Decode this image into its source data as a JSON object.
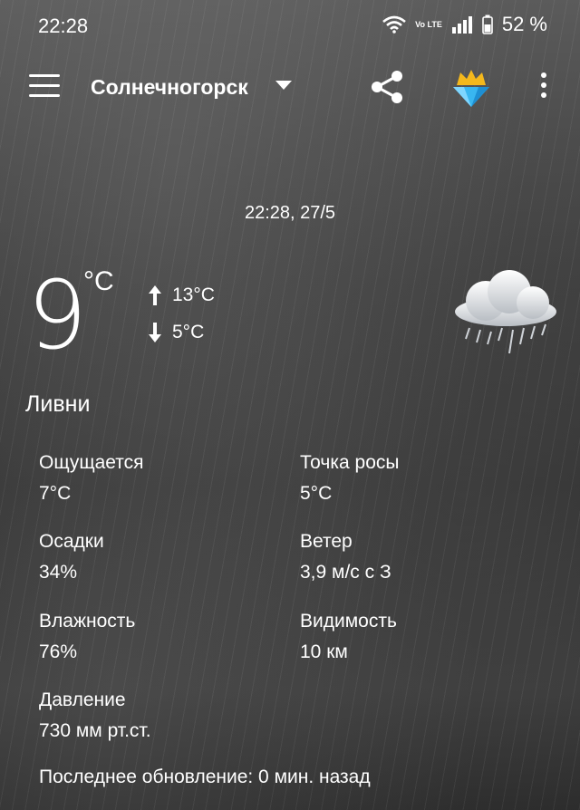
{
  "status_bar": {
    "time": "22:28",
    "battery_percent": "52 %",
    "network_label": "Vo LTE",
    "icons": [
      "wifi-icon",
      "volte-icon",
      "signal-icon",
      "battery-icon"
    ]
  },
  "app_bar": {
    "city": "Солнечногорск",
    "icons": [
      "menu-icon",
      "dropdown-icon",
      "share-icon",
      "premium-crown-icon",
      "more-icon"
    ]
  },
  "weather": {
    "updated_at": "22:28, 27/5",
    "temperature": "9",
    "unit": "°C",
    "high": "13°C",
    "low": "5°C",
    "condition": "Ливни",
    "condition_icon": "rain-cloud-icon"
  },
  "details": [
    {
      "label": "Ощущается",
      "value": "7°C"
    },
    {
      "label": "Точка росы",
      "value": "5°C"
    },
    {
      "label": "Осадки",
      "value": "34%"
    },
    {
      "label": "Ветер",
      "value": "3,9 м/с с З"
    },
    {
      "label": "Влажность",
      "value": "76%"
    },
    {
      "label": "Видимость",
      "value": "10 км"
    },
    {
      "label": "Давление",
      "value": "730 мм рт.ст."
    }
  ],
  "last_update": "Последнее обновление: 0 мин. назад"
}
